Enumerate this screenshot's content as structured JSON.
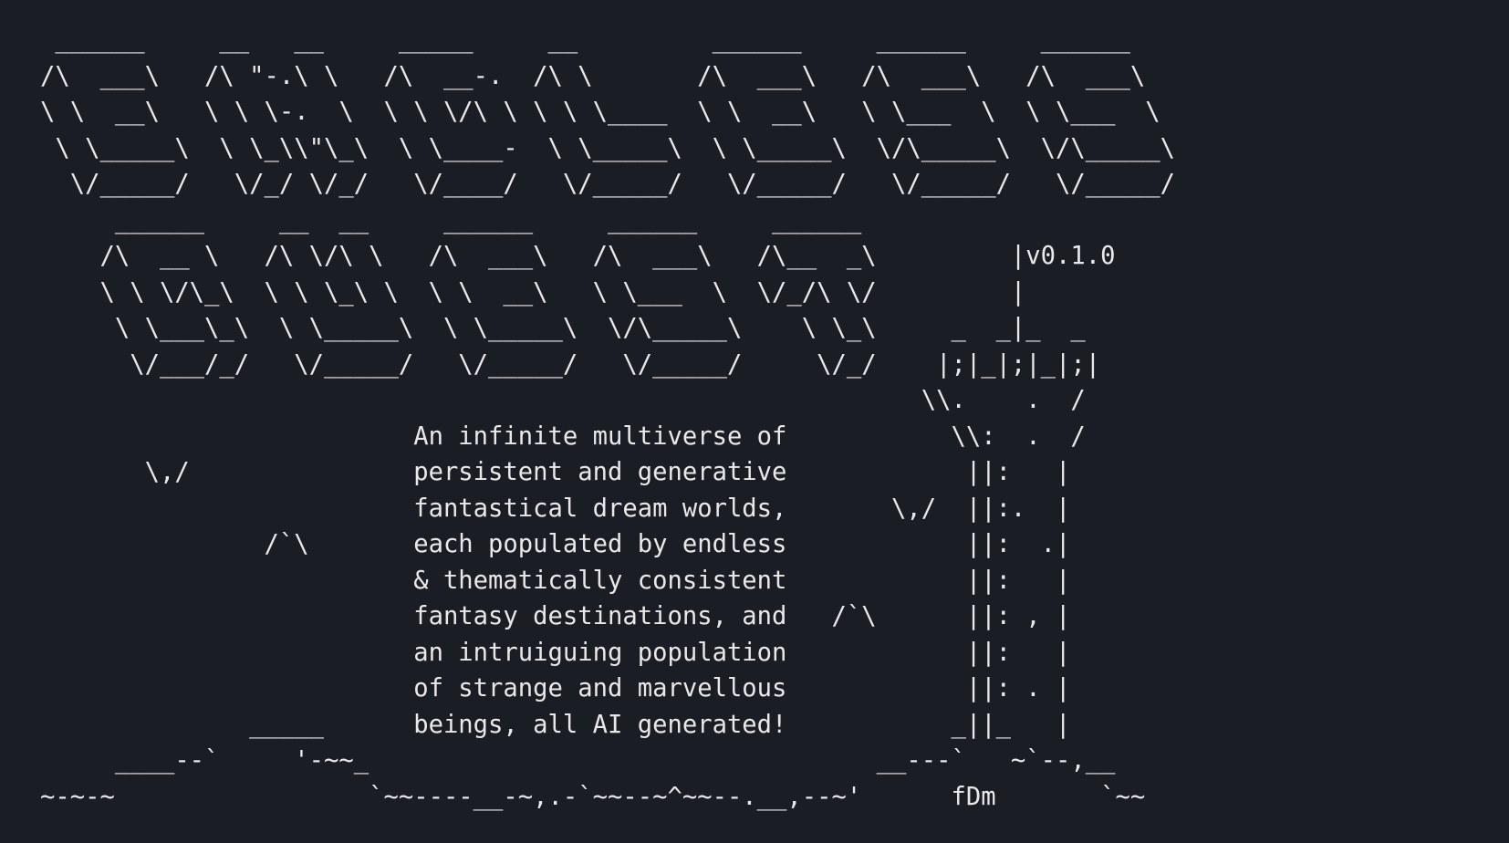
{
  "terminal": {
    "background_color": "#1b1d24",
    "text_color": "#e8e8ea",
    "lines": [
      " ______     __   __     _____     __         ______     ______     ______",
      "/\\  ___\\   /\\ \"-.\\ \\   /\\  __-.  /\\ \\       /\\  ___\\   /\\  ___\\   /\\  ___\\",
      "\\ \\  __\\   \\ \\ \\-.  \\  \\ \\ \\/\\ \\ \\ \\ \\____  \\ \\  __\\   \\ \\___  \\  \\ \\___  \\",
      " \\ \\_____\\  \\ \\_\\\\\"\\_\\  \\ \\____-  \\ \\_____\\  \\ \\_____\\  \\/\\_____\\  \\/\\_____\\",
      "  \\/_____/   \\/_/ \\/_/   \\/____/   \\/_____/   \\/_____/   \\/_____/   \\/_____/",
      "     ______     __  __     ______     ______     ______",
      "    /\\  __ \\   /\\ \\/\\ \\   /\\  ___\\   /\\  ___\\   /\\__  _\\         |v0.1.0",
      "    \\ \\ \\/\\_\\  \\ \\ \\_\\ \\  \\ \\  __\\   \\ \\___  \\  \\/_/\\ \\/         |",
      "     \\ \\___\\_\\  \\ \\_____\\  \\ \\_____\\  \\/\\_____\\    \\ \\_\\     _  _|_  _",
      "      \\/___/_/   \\/_____/   \\/_____/   \\/_____/     \\/_/    |;|_|;|_|;|",
      "                                                           \\\\.    .  /",
      "                         An infinite multiverse of           \\\\:  .  /",
      "       \\,/               persistent and generative            ||:   |",
      "                         fantastical dream worlds,       \\,/  ||:.  |",
      "               /`\\       each populated by endless            ||:  .|",
      "                         & thematically consistent            ||:   |",
      "                         fantasy destinations, and   /`\\      ||: , |",
      "                         an intruiguing population            ||:   |",
      "                         of strange and marvellous            ||: . |",
      "              _____      beings, all AI generated!           _||_   |",
      "     ____--`     '-~~_                                  __---`   ~`--,__",
      "~-~-~                 `~~----__-~,.-`~~--~^~~--.__,--~'      fDm       `~~"
    ]
  }
}
